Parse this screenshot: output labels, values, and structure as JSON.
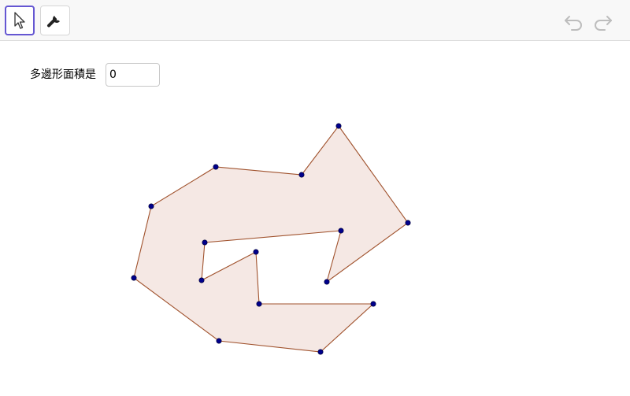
{
  "toolbar": {
    "move_tool": {
      "icon": "cursor-arrow-icon",
      "selected": true
    },
    "settings_tool": {
      "icon": "wrench-icon"
    },
    "undo": {
      "icon": "undo-icon"
    },
    "redo": {
      "icon": "redo-icon"
    }
  },
  "area_field": {
    "label": "多邊形面積是",
    "value": "0"
  },
  "colors": {
    "polygon_fill": "#f5e8e4",
    "polygon_stroke": "#a0522d",
    "vertex": "#00008b",
    "accent": "#6557d2"
  }
}
